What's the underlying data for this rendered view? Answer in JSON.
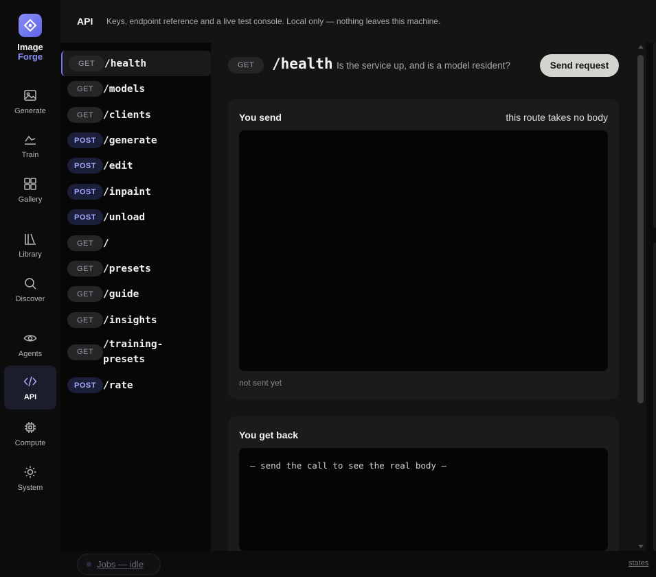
{
  "app": {
    "name_line1": "Image",
    "name_line2": "Forge"
  },
  "nav": [
    {
      "label": "Generate",
      "icon": "image-icon"
    },
    {
      "label": "Train",
      "icon": "chart-line-icon"
    },
    {
      "label": "Gallery",
      "icon": "grid-icon"
    },
    {
      "label": "Library",
      "icon": "library-icon"
    },
    {
      "label": "Discover",
      "icon": "search-icon"
    },
    {
      "label": "Agents",
      "icon": "eye-icon"
    },
    {
      "label": "API",
      "icon": "code-icon",
      "active": true
    },
    {
      "label": "Compute",
      "icon": "chip-icon"
    },
    {
      "label": "System",
      "icon": "sun-icon"
    }
  ],
  "header": {
    "title": "API",
    "subtitle": "Keys, endpoint reference and a live test console. Local only — nothing leaves this machine."
  },
  "routes": [
    {
      "method": "GET",
      "path": "/health",
      "active": true
    },
    {
      "method": "GET",
      "path": "/models"
    },
    {
      "method": "GET",
      "path": "/clients"
    },
    {
      "method": "POST",
      "path": "/generate"
    },
    {
      "method": "POST",
      "path": "/edit"
    },
    {
      "method": "POST",
      "path": "/inpaint"
    },
    {
      "method": "POST",
      "path": "/unload"
    },
    {
      "method": "GET",
      "path": "/"
    },
    {
      "method": "GET",
      "path": "/presets"
    },
    {
      "method": "GET",
      "path": "/guide"
    },
    {
      "method": "GET",
      "path": "/insights"
    },
    {
      "method": "GET",
      "path": "/training-presets"
    },
    {
      "method": "POST",
      "path": "/rate"
    }
  ],
  "detail": {
    "method": "GET",
    "path": "/health",
    "description": "Is the service up, and is a model resident?",
    "send_label": "Send request",
    "send_card": {
      "title": "You send",
      "note": "this route takes no body",
      "status": "not sent yet"
    },
    "back_card": {
      "title": "You get back",
      "placeholder": "— send the call to see the real body —"
    }
  },
  "footer": {
    "jobs_label": "Jobs — idle",
    "states_label": "states"
  },
  "colors": {
    "accent": "#6f74e8",
    "post_badge": "#a4a8ff",
    "button_bg": "#d5d5d0"
  }
}
